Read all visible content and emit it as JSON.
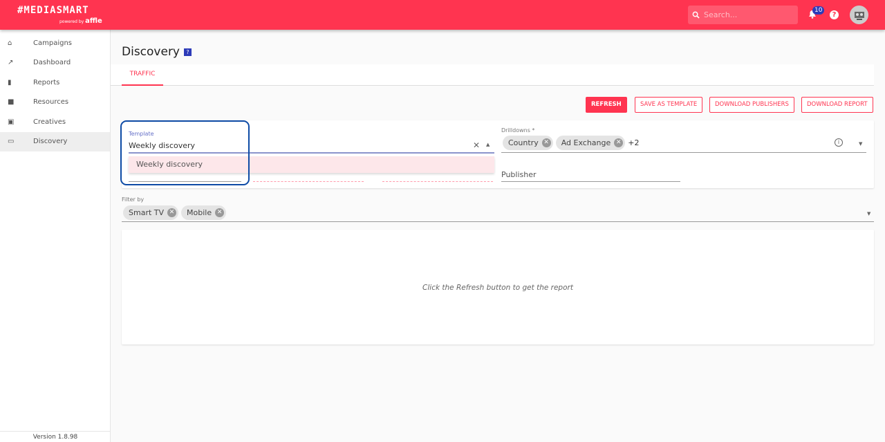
{
  "header": {
    "logo": "#MEDIASMART",
    "logo_sub": "powered by",
    "logo_brand": "affle",
    "search_placeholder": "Search...",
    "notifications": "10",
    "help": "?"
  },
  "sidebar": {
    "items": [
      {
        "label": "Campaigns",
        "icon": "home-icon"
      },
      {
        "label": "Dashboard",
        "icon": "trend-icon"
      },
      {
        "label": "Reports",
        "icon": "bar-chart-icon"
      },
      {
        "label": "Resources",
        "icon": "widgets-icon"
      },
      {
        "label": "Creatives",
        "icon": "image-icon"
      },
      {
        "label": "Discovery",
        "icon": "laptop-search-icon",
        "active": true
      }
    ],
    "version": "Version 1.8.98"
  },
  "page": {
    "title": "Discovery",
    "tab": "TRAFFIC"
  },
  "toolbar": {
    "refresh": "REFRESH",
    "save_template": "SAVE AS TEMPLATE",
    "download_publishers": "DOWNLOAD PUBLISHERS",
    "download_report": "DOWNLOAD REPORT"
  },
  "form": {
    "template_label": "Template",
    "template_value": "Weekly discovery",
    "template_option": "Weekly discovery",
    "drilldowns_label": "Drilldowns *",
    "drilldowns": [
      "Country",
      "Ad Exchange"
    ],
    "drilldowns_more": "+2",
    "publisher_placeholder": "Publisher",
    "filter_label": "Filter by",
    "filters": [
      "Smart TV",
      "Mobile"
    ]
  },
  "report": {
    "empty_message": "Click the Refresh button to get the report"
  },
  "colors": {
    "brand": "#ff3450",
    "accent": "#2d3bb8",
    "focus": "#0d4aa5"
  }
}
